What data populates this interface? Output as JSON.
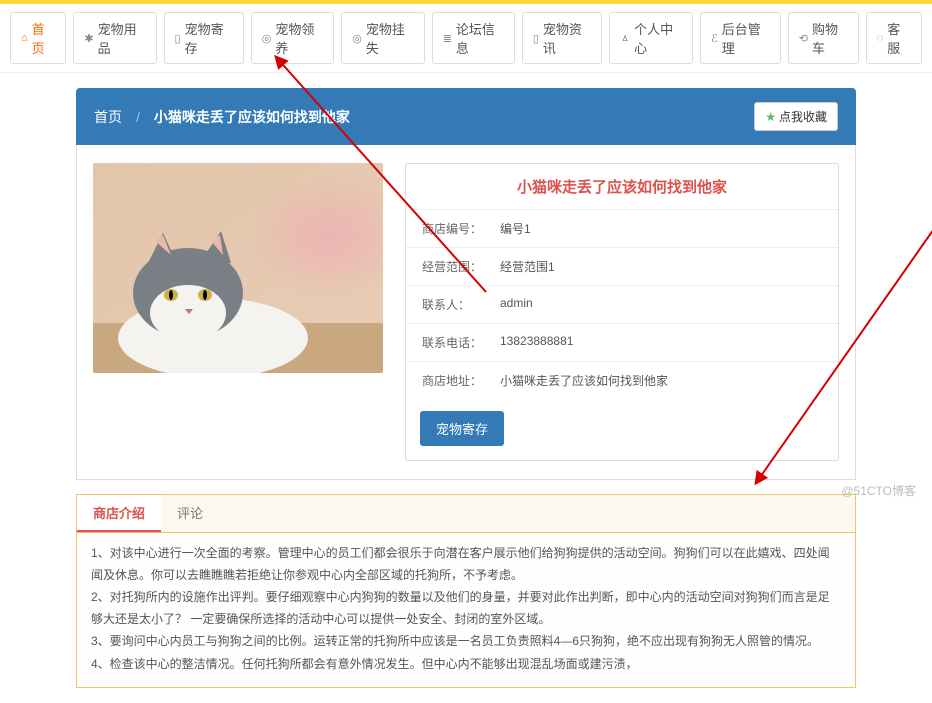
{
  "nav": {
    "items": [
      {
        "icon": "⌂",
        "label": "首页",
        "active": true
      },
      {
        "icon": "✱",
        "label": "宠物用品"
      },
      {
        "icon": "▯",
        "label": "宠物寄存"
      },
      {
        "icon": "◎",
        "label": "宠物领养"
      },
      {
        "icon": "◎",
        "label": "宠物挂失"
      },
      {
        "icon": "≣",
        "label": "论坛信息"
      },
      {
        "icon": "▯",
        "label": "宠物资讯"
      },
      {
        "icon": "ㅿ",
        "label": "个人中心"
      },
      {
        "icon": "ℰ",
        "label": "后台管理"
      },
      {
        "icon": "⟲",
        "label": "购物车"
      },
      {
        "icon": "◌",
        "label": "客服"
      }
    ]
  },
  "breadcrumb": {
    "home": "首页",
    "current": "小猫咪走丢了应该如何找到他家"
  },
  "favorite_label": "点我收藏",
  "detail": {
    "title": "小猫咪走丢了应该如何找到他家",
    "rows": [
      {
        "label": "商店编号：",
        "value": "编号1"
      },
      {
        "label": "经营范围：",
        "value": "经营范围1"
      },
      {
        "label": "联系人：",
        "value": "admin"
      },
      {
        "label": "联系电话：",
        "value": "13823888881"
      },
      {
        "label": "商店地址：",
        "value": "小猫咪走丢了应该如何找到他家"
      }
    ],
    "cta": "宠物寄存"
  },
  "tabs": [
    {
      "label": "商店介绍",
      "active": true
    },
    {
      "label": "评论"
    }
  ],
  "store_intro": [
    "1、对该中心进行一次全面的考察。管理中心的员工们都会很乐于向潜在客户展示他们给狗狗提供的活动空间。狗狗们可以在此嬉戏、四处闻闻及休息。你可以去瞧瞧瞧若拒绝让你参观中心内全部区域的托狗所，不予考虑。",
    "2、对托狗所内的设施作出评判。要仔细观察中心内狗狗的数量以及他们的身量，并要对此作出判断，即中心内的活动空间对狗狗们而言是足够大还是太小了？ 一定要确保所选择的活动中心可以提供一处安全、封闭的室外区域。",
    "3、要询问中心内员工与狗狗之间的比例。运转正常的托狗所中应该是一名员工负责照料4—6只狗狗，绝不应出现有狗狗无人照管的情况。",
    "4、检查该中心的整洁情况。任何托狗所都会有意外情况发生。但中心内不能够出现混乱场面或建污渍，"
  ],
  "watermark": "@51CTO博客"
}
